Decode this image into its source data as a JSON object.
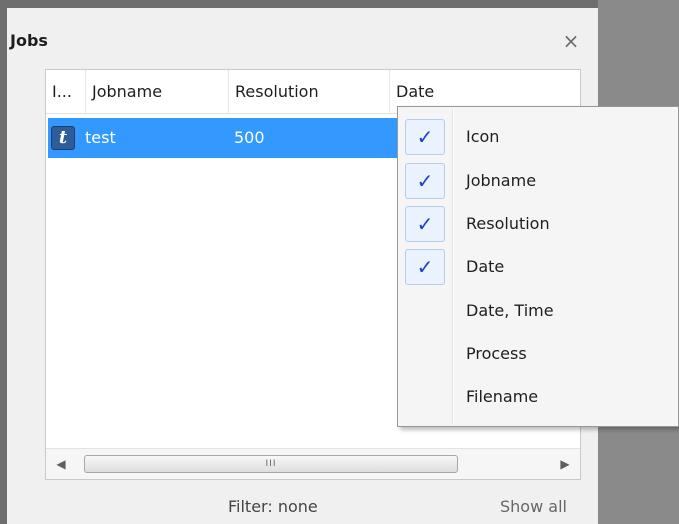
{
  "window": {
    "title": "Jobs",
    "close_icon": "×"
  },
  "columns": [
    "I...",
    "Jobname",
    "Resolution",
    "Date"
  ],
  "rows": [
    {
      "icon": "t",
      "jobname": "test",
      "resolution": "500"
    }
  ],
  "scrollbar": {
    "left_arrow": "◀",
    "right_arrow": "▶",
    "grip": "III"
  },
  "footer": {
    "filter": "Filter: none",
    "show_all": "Show all"
  },
  "context_menu": {
    "check": "✓",
    "items": [
      {
        "label": "Icon",
        "checked": true
      },
      {
        "label": "Jobname",
        "checked": true
      },
      {
        "label": "Resolution",
        "checked": true
      },
      {
        "label": "Date",
        "checked": true
      },
      {
        "label": "Date, Time",
        "checked": false
      },
      {
        "label": "Process",
        "checked": false
      },
      {
        "label": "Filename",
        "checked": false
      }
    ]
  },
  "colors": {
    "selection": "#3399ff",
    "check": "#1a3fd6"
  }
}
